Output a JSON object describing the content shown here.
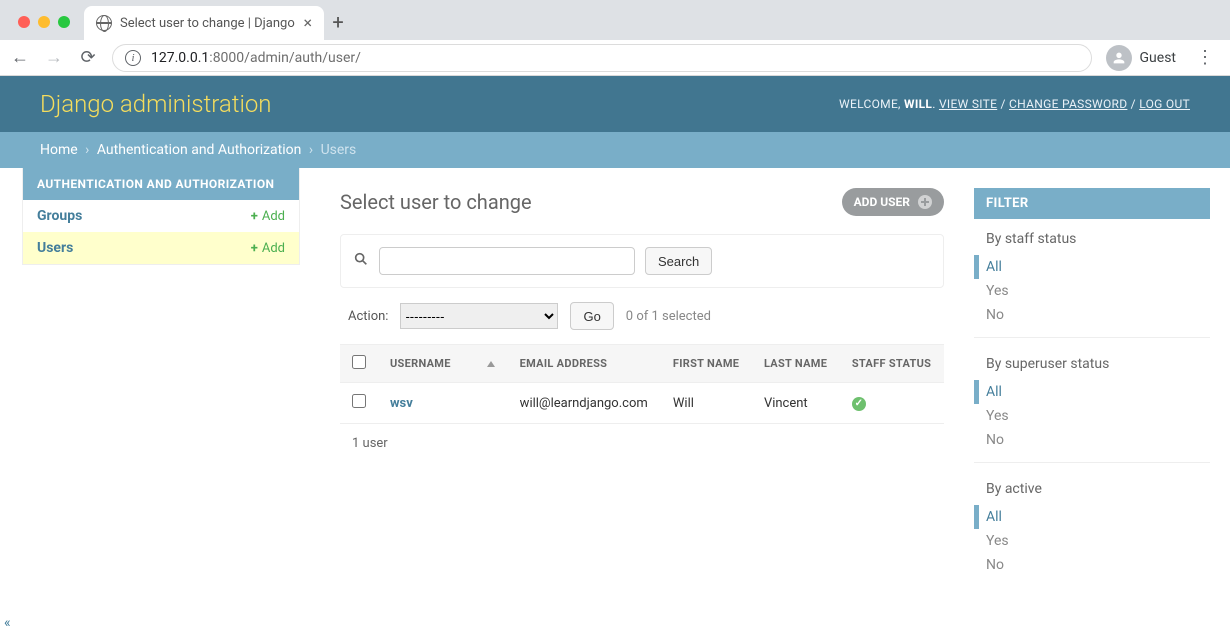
{
  "browser": {
    "tab_title": "Select user to change | Django",
    "url_host": "127.0.0.1",
    "url_port": ":8000",
    "url_path": "/admin/auth/user/",
    "guest_label": "Guest"
  },
  "header": {
    "brand": "Django administration",
    "welcome": "WELCOME,",
    "username": "WILL",
    "view_site": "VIEW SITE",
    "change_password": "CHANGE PASSWORD",
    "logout": "LOG OUT"
  },
  "breadcrumbs": {
    "home": "Home",
    "app": "Authentication and Authorization",
    "model": "Users"
  },
  "sidebar": {
    "caption": "AUTHENTICATION AND AUTHORIZATION",
    "items": [
      {
        "label": "Groups",
        "add": "Add",
        "selected": false
      },
      {
        "label": "Users",
        "add": "Add",
        "selected": true
      }
    ]
  },
  "page": {
    "title": "Select user to change",
    "add_button": "ADD USER",
    "search_button": "Search",
    "action_label": "Action:",
    "action_placeholder": "---------",
    "go_button": "Go",
    "selection_counter": "0 of 1 selected",
    "paginator": "1 user"
  },
  "table": {
    "columns": [
      "USERNAME",
      "EMAIL ADDRESS",
      "FIRST NAME",
      "LAST NAME",
      "STAFF STATUS"
    ],
    "rows": [
      {
        "username": "wsv",
        "email": "will@learndjango.com",
        "first": "Will",
        "last": "Vincent",
        "staff": true
      }
    ]
  },
  "filters": {
    "caption": "FILTER",
    "sections": [
      {
        "title": "By staff status",
        "options": [
          "All",
          "Yes",
          "No"
        ],
        "selected": "All"
      },
      {
        "title": "By superuser status",
        "options": [
          "All",
          "Yes",
          "No"
        ],
        "selected": "All"
      },
      {
        "title": "By active",
        "options": [
          "All",
          "Yes",
          "No"
        ],
        "selected": "All"
      }
    ]
  }
}
